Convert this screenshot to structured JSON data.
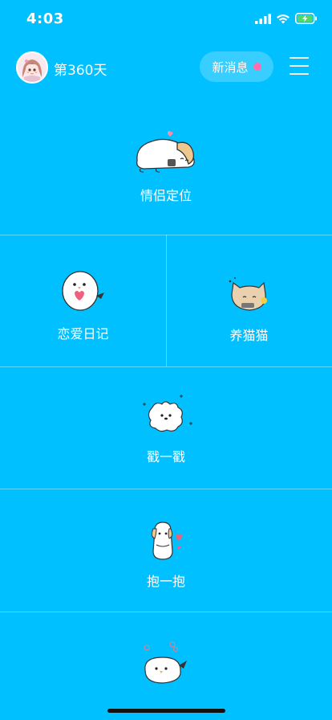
{
  "status": {
    "time": "4:03"
  },
  "header": {
    "day_label": "第360天",
    "new_message_label": "新消息"
  },
  "menu": [
    {
      "label": "情侣定位",
      "icon": "sleeping-dog-icon"
    },
    {
      "label": "恋爱日记",
      "icon": "bird-heart-icon"
    },
    {
      "label": "养猫猫",
      "icon": "cat-icon"
    },
    {
      "label": "戳一戳",
      "icon": "fluffy-dog-icon"
    },
    {
      "label": "抱一抱",
      "icon": "hugging-dog-icon"
    },
    {
      "label": "",
      "icon": "chick-icon"
    }
  ],
  "colors": {
    "background": "#00C0FF",
    "message_dot": "#ff6fb0"
  }
}
